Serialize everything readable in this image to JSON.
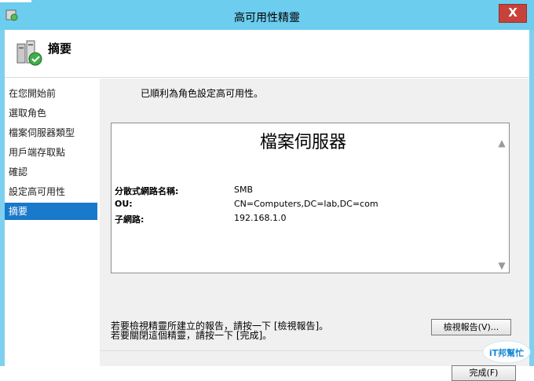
{
  "window": {
    "title": "高可用性精靈",
    "close_label": "X"
  },
  "header": {
    "title": "摘要"
  },
  "nav": {
    "items": [
      {
        "label": "在您開始前",
        "selected": false
      },
      {
        "label": "選取角色",
        "selected": false
      },
      {
        "label": "檔案伺服器類型",
        "selected": false
      },
      {
        "label": "用戶端存取點",
        "selected": false
      },
      {
        "label": "確認",
        "selected": false
      },
      {
        "label": "設定高可用性",
        "selected": false
      },
      {
        "label": "摘要",
        "selected": true
      }
    ]
  },
  "main": {
    "success_message": "已順利為角色設定高可用性。",
    "report": {
      "title": "檔案伺服器",
      "rows": [
        {
          "label": "分散式網路名稱:",
          "value": "SMB"
        },
        {
          "label": "OU:",
          "value": "CN=Computers,DC=lab,DC=com"
        },
        {
          "label": "子網路:",
          "value": "192.168.1.0"
        }
      ]
    },
    "help_line_1": "若要檢視精靈所建立的報告，請按一下 [檢視報告]。",
    "help_line_2": "若要關閉這個精靈，請按一下 [完成]。",
    "view_report_button": "檢視報告(V)...",
    "finish_button": "完成(F)"
  },
  "watermark": {
    "text": "iT邦幫忙"
  },
  "colors": {
    "titlebar": "#6ccdee",
    "selected_nav": "#1979ca",
    "close_button": "#c7423b"
  }
}
